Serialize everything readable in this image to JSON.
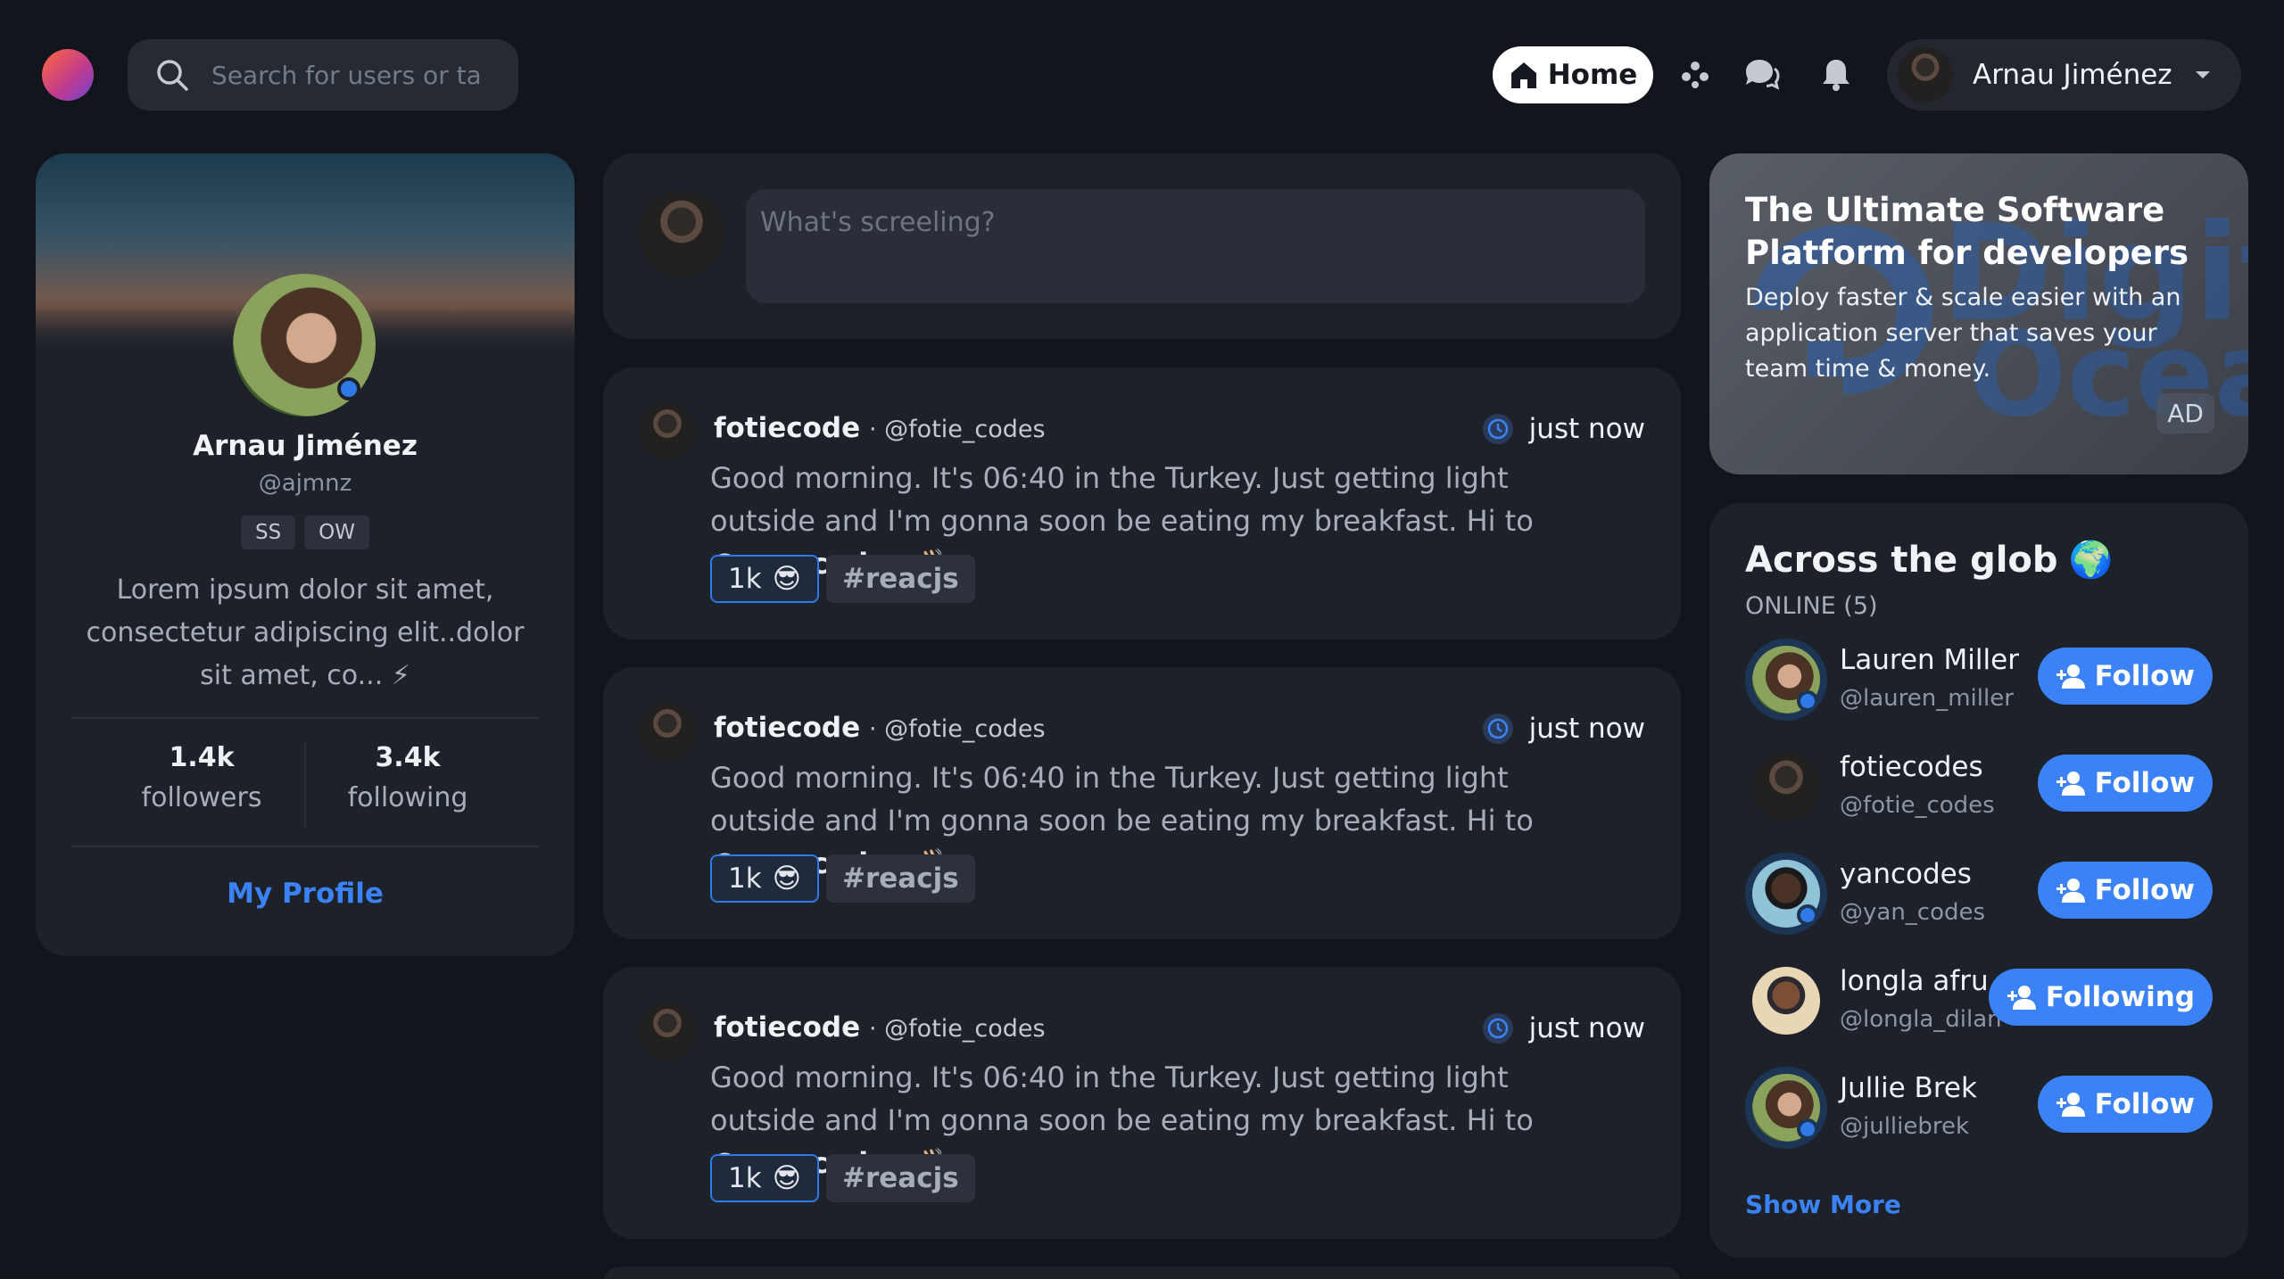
{
  "topbar": {
    "search_placeholder": "Search for users or ta",
    "home_label": "Home",
    "user_name": "Arnau Jiménez"
  },
  "profile": {
    "name": "Arnau Jiménez",
    "handle": "@ajmnz",
    "tags": [
      "SS",
      "OW"
    ],
    "bio": "Lorem ipsum dolor sit amet, consectetur adipiscing elit..dolor sit amet, co... ⚡",
    "followers_count": "1.4k",
    "followers_label": "followers",
    "following_count": "3.4k",
    "following_label": "following",
    "my_profile_label": "My Profile"
  },
  "composer": {
    "placeholder": "What's screeling?"
  },
  "posts": [
    {
      "author": "fotiecode",
      "handle": "@fotie_codes",
      "time": "just now",
      "body_text": "Good morning. It's 06:40 in the Turkey. Just getting light outside and I'm gonna soon be eating my breakfast. Hi to ",
      "mention": "@yan_codes",
      "emoji": "👋🏼",
      "likes": "1k",
      "reaction": "😎",
      "hashtag": "#reacjs"
    },
    {
      "author": "fotiecode",
      "handle": "@fotie_codes",
      "time": "just now",
      "body_text": "Good morning. It's 06:40 in the Turkey. Just getting light outside and I'm gonna soon be eating my breakfast. Hi to ",
      "mention": "@yan_codes",
      "emoji": "👋🏼",
      "likes": "1k",
      "reaction": "😎",
      "hashtag": "#reacjs"
    },
    {
      "author": "fotiecode",
      "handle": "@fotie_codes",
      "time": "just now",
      "body_text": "Good morning. It's 06:40 in the Turkey. Just getting light outside and I'm gonna soon be eating my breakfast. Hi to ",
      "mention": "@yan_codes",
      "emoji": "👋🏼",
      "likes": "1k",
      "reaction": "😎",
      "hashtag": "#reacjs"
    }
  ],
  "ad": {
    "title": "The Ultimate Software Platform for developers",
    "description": "Deploy faster & scale easier with an application server that saves your team time & money.",
    "label": "AD",
    "watermark_top": "Digit",
    "watermark_bottom": "Ocea"
  },
  "glob": {
    "title": "Across the glob",
    "title_emoji": "🌍",
    "online_label": "ONLINE (5)",
    "people": [
      {
        "name": "Lauren Miller",
        "handle": "@lauren_miller",
        "button": "Follow",
        "online": true
      },
      {
        "name": "fotiecodes",
        "handle": "@fotie_codes",
        "button": "Follow",
        "online": false
      },
      {
        "name": "yancodes",
        "handle": "@yan_codes",
        "button": "Follow",
        "online": true
      },
      {
        "name": "longla afru",
        "handle": "@longla_dilan",
        "button": "Following",
        "online": false
      },
      {
        "name": "Jullie Brek",
        "handle": "@julliebrek",
        "button": "Follow",
        "online": true
      }
    ],
    "show_more": "Show More"
  },
  "colors": {
    "background": "#12151c",
    "card": "#1d212a",
    "accent": "#3b82f6"
  }
}
